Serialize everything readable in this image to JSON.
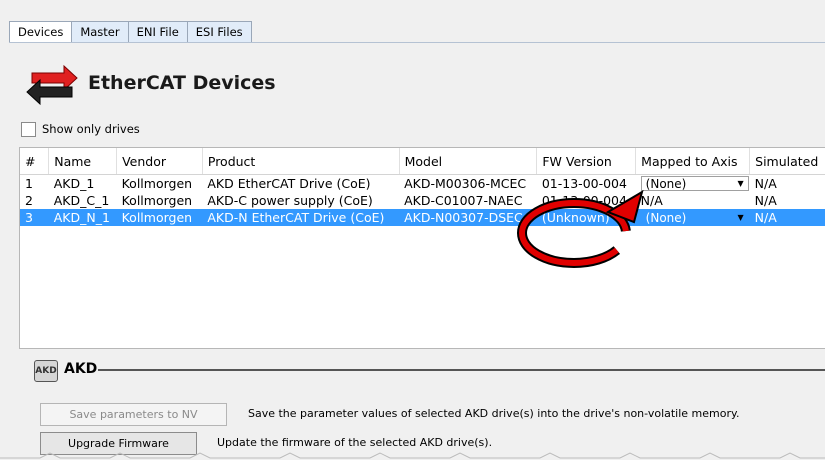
{
  "tabs": [
    "Devices",
    "Master",
    "ENI File",
    "ESI Files"
  ],
  "page_title": "EtherCAT Devices",
  "show_only_drives": {
    "label": "Show only drives",
    "checked": false
  },
  "table": {
    "columns": [
      "#",
      "Name",
      "Vendor",
      "Product",
      "Model",
      "FW Version",
      "Mapped to Axis",
      "Simulated"
    ],
    "rows": [
      {
        "num": "1",
        "name": "AKD_1",
        "vendor": "Kollmorgen",
        "product": "AKD EtherCAT Drive (CoE)",
        "model": "AKD-M00306-MCEC",
        "fw": "01-13-00-004",
        "mapped": "(None)",
        "simulated": "N/A"
      },
      {
        "num": "2",
        "name": "AKD_C_1",
        "vendor": "Kollmorgen",
        "product": "AKD-C power supply (CoE)",
        "model": "AKD-C01007-NAEC",
        "fw": "01-13-00-004",
        "mapped": "N/A",
        "simulated": "N/A"
      },
      {
        "num": "3",
        "name": "AKD_N_1",
        "vendor": "Kollmorgen",
        "product": "AKD-N EtherCAT Drive (CoE)",
        "model": "AKD-N00307-DSEC",
        "fw": "(Unknown)",
        "mapped": "(None)",
        "simulated": "N/A"
      }
    ]
  },
  "section": {
    "icon_text": "AKD",
    "title": "AKD"
  },
  "save_params": {
    "label": "Save parameters to NV memory",
    "description": "Save the parameter values of selected AKD drive(s) into the drive's non-volatile memory."
  },
  "upgrade": {
    "label": "Upgrade Firmware",
    "description": "Update the firmware of the selected AKD drive(s)."
  },
  "colors": {
    "selection": "#3399ff",
    "annotation": "#e00000",
    "tab_bg": "#e1ecf9"
  },
  "icons": {
    "header": "ethercat-arrows-icon",
    "section": "akd-drive-icon",
    "overlay": "red-circle-arrow-annotation"
  }
}
